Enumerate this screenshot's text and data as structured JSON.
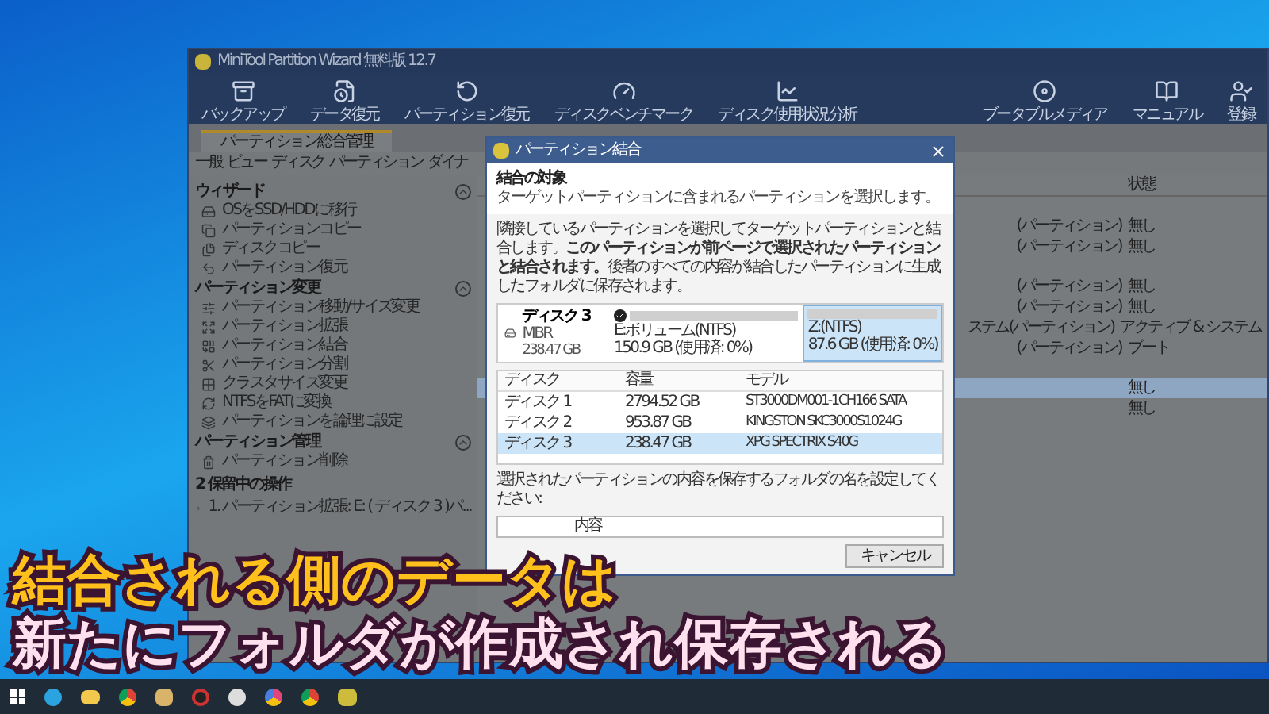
{
  "window": {
    "title": "MiniTool Partition Wizard 無料版 12.7"
  },
  "toolbar": {
    "left": [
      "バックアップ",
      "データ復元",
      "パーティション復元",
      "ディスクベンチマーク",
      "ディスク使用状況分析"
    ],
    "right": [
      "ブータブルメディア",
      "マニュアル",
      "登録"
    ]
  },
  "tabs": [
    {
      "label": "パーティション総合管理",
      "selected": true
    }
  ],
  "menu": [
    "一般",
    "ビュー",
    "ディスク",
    "パーティション",
    "ダイナ"
  ],
  "sidebar": {
    "sections": [
      {
        "title": "ウィザード",
        "expanded": true,
        "items": [
          "OSをSSD/HDDに移行",
          "パーティションコピー",
          "ディスクコピー",
          "パーティション復元"
        ]
      },
      {
        "title": "パーティション変更",
        "expanded": true,
        "items": [
          "パーティション移動/サイズ変更",
          "パーティション拡張",
          "パーティション結合",
          "パーティション分割",
          "クラスタサイズ変更",
          "NTFSをFATに変換",
          "パーティションを論理に設定"
        ]
      },
      {
        "title": "パーティション管理",
        "expanded": true,
        "items": [
          "パーティション削除"
        ]
      }
    ],
    "pending": {
      "title": "2 保留中の操作",
      "items": [
        "1. パーティション拡張: E: ( ディスク 3 )パ..."
      ]
    }
  },
  "main_table": {
    "columns": [
      "状態"
    ],
    "rows": [
      {
        "kind": "spacer"
      },
      {
        "kind": "row",
        "column_2": "(パーティション)",
        "status": "無し",
        "selected": false
      },
      {
        "kind": "row",
        "column_2": "(パーティション)",
        "status": "無し",
        "selected": false
      },
      {
        "kind": "spacer"
      },
      {
        "kind": "row",
        "column_2": "(パーティション)",
        "status": "無し",
        "selected": false
      },
      {
        "kind": "row",
        "column_2": "(パーティション)",
        "status": "無し",
        "selected": false
      },
      {
        "kind": "row",
        "column_2": "ステム(パーティション)",
        "status": "アクティブ & システム",
        "selected": false
      },
      {
        "kind": "row",
        "column_2": "(パーティション)",
        "status": "ブート",
        "selected": false
      },
      {
        "kind": "spacer"
      },
      {
        "kind": "row",
        "status": "無し",
        "selected": true
      },
      {
        "kind": "row",
        "status": "無し",
        "selected": false
      }
    ]
  },
  "dialog": {
    "title": "パーティション結合",
    "heading": "結合の対象",
    "subheading": "ターゲットパーティションに含まれるパーティションを選択します。",
    "description": "隣接しているパーティションを選択してターゲットパーティションと結合します。**このパーティションが前ページで選択されたパーティションと結合されます。**後者のすべての内容が結合したパーティションに生成したフォルダに保存されます。",
    "disk": {
      "name": "ディスク 3",
      "type": "MBR",
      "size": "238.47 GB"
    },
    "partitions": [
      {
        "label": "E:ボリューム(NTFS)",
        "size": "150.9 GB (使用済: 0%)",
        "checked": true,
        "selected": false
      },
      {
        "label": "Z:(NTFS)",
        "size": "87.6 GB (使用済: 0%)",
        "checked": false,
        "selected": true
      }
    ],
    "table": {
      "columns": [
        "ディスク",
        "容量",
        "モデル"
      ],
      "rows": [
        {
          "disk": "ディスク 1",
          "capacity": "2794.52 GB",
          "model": "ST3000DM001-1CH166 SATA",
          "selected": false
        },
        {
          "disk": "ディスク 2",
          "capacity": "953.87 GB",
          "model": "KINGSTON SKC3000S1024G",
          "selected": false
        },
        {
          "disk": "ディスク 3",
          "capacity": "238.47 GB",
          "model": "XPG SPECTRIX S40G",
          "selected": true
        }
      ]
    },
    "folder_label": "選択されたパーティションの内容を保存するフォルダの名を設定してください:",
    "folder_value": "内容",
    "buttons": [
      "キャンセル"
    ]
  },
  "caption": {
    "lines": [
      "結合される側のデータは",
      "新たにフォルダが作成され保存される"
    ]
  }
}
